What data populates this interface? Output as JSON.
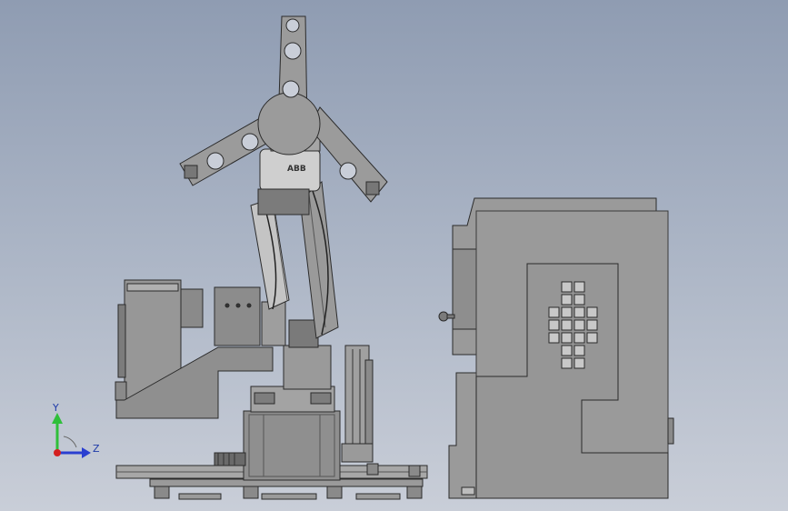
{
  "robot": {
    "logo_text": "ABB"
  },
  "triad": {
    "y_label": "Y",
    "z_label": "Z",
    "y_color": "#2fbf3a",
    "z_color": "#2a3fd0",
    "x_color": "#d42020"
  },
  "colors": {
    "part_fill": "#8e8e8e",
    "part_light": "#b5b5b5",
    "part_dark": "#6c6c6c",
    "edge": "#2b2b2b"
  }
}
